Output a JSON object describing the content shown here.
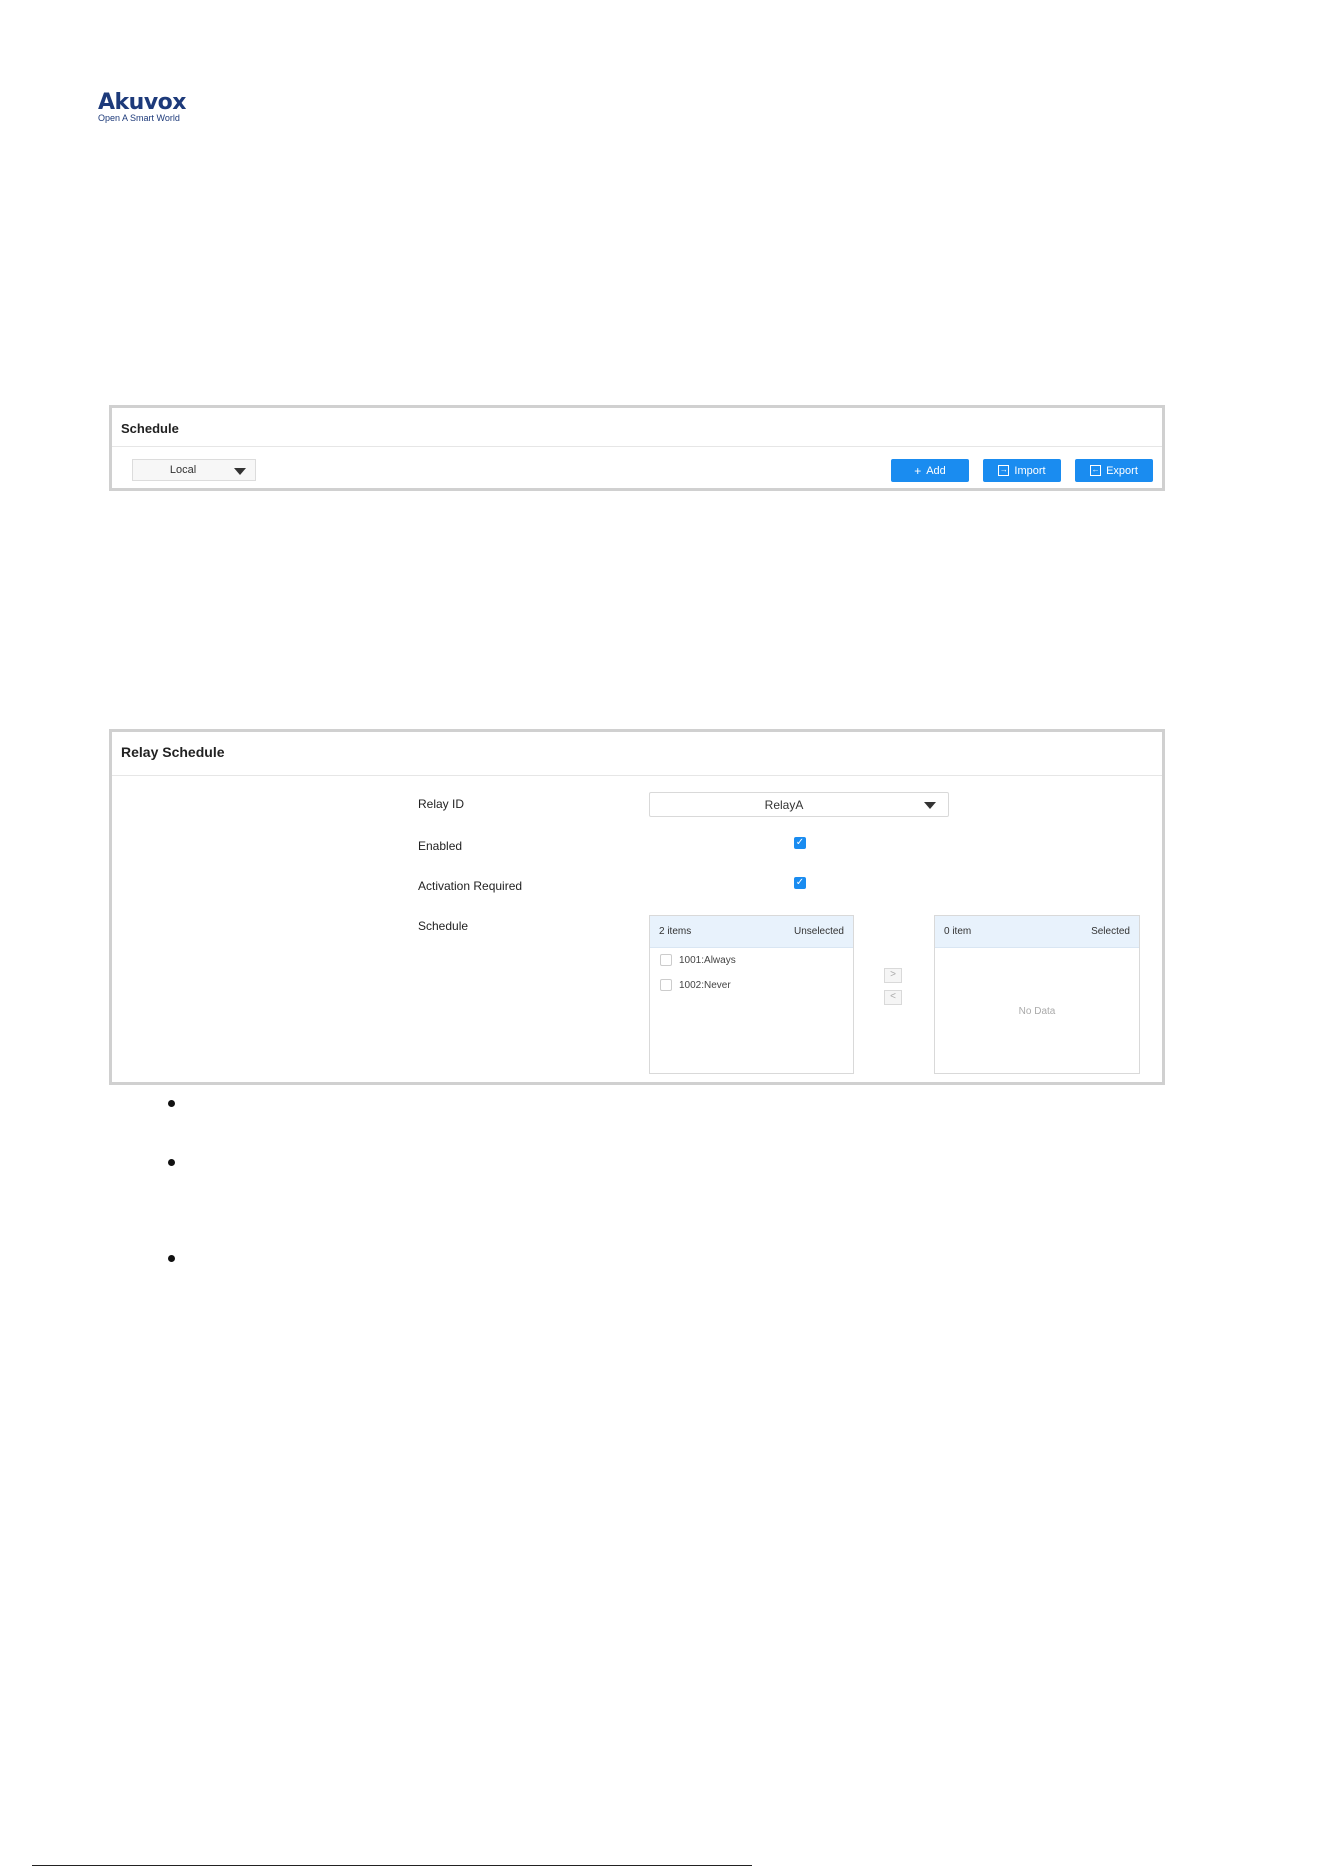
{
  "brand": {
    "name": "Akuvox",
    "tagline": "Open A Smart World"
  },
  "schedule_panel": {
    "title": "Schedule",
    "source_select": {
      "value": "Local"
    },
    "buttons": {
      "add": "Add",
      "import": "Import",
      "export": "Export"
    }
  },
  "relay_panel": {
    "title": "Relay Schedule",
    "relay_id_label": "Relay ID",
    "relay_id_value": "RelayA",
    "enabled_label": "Enabled",
    "enabled": true,
    "activation_label": "Activation Required",
    "activation_required": true,
    "schedule_label": "Schedule",
    "transfer": {
      "left": {
        "count": "2 items",
        "title": "Unselected",
        "items": [
          "1001:Always",
          "1002:Never"
        ]
      },
      "right": {
        "count": "0 item",
        "title": "Selected",
        "empty": "No Data"
      },
      "move_right": ">",
      "move_left": "<"
    }
  }
}
